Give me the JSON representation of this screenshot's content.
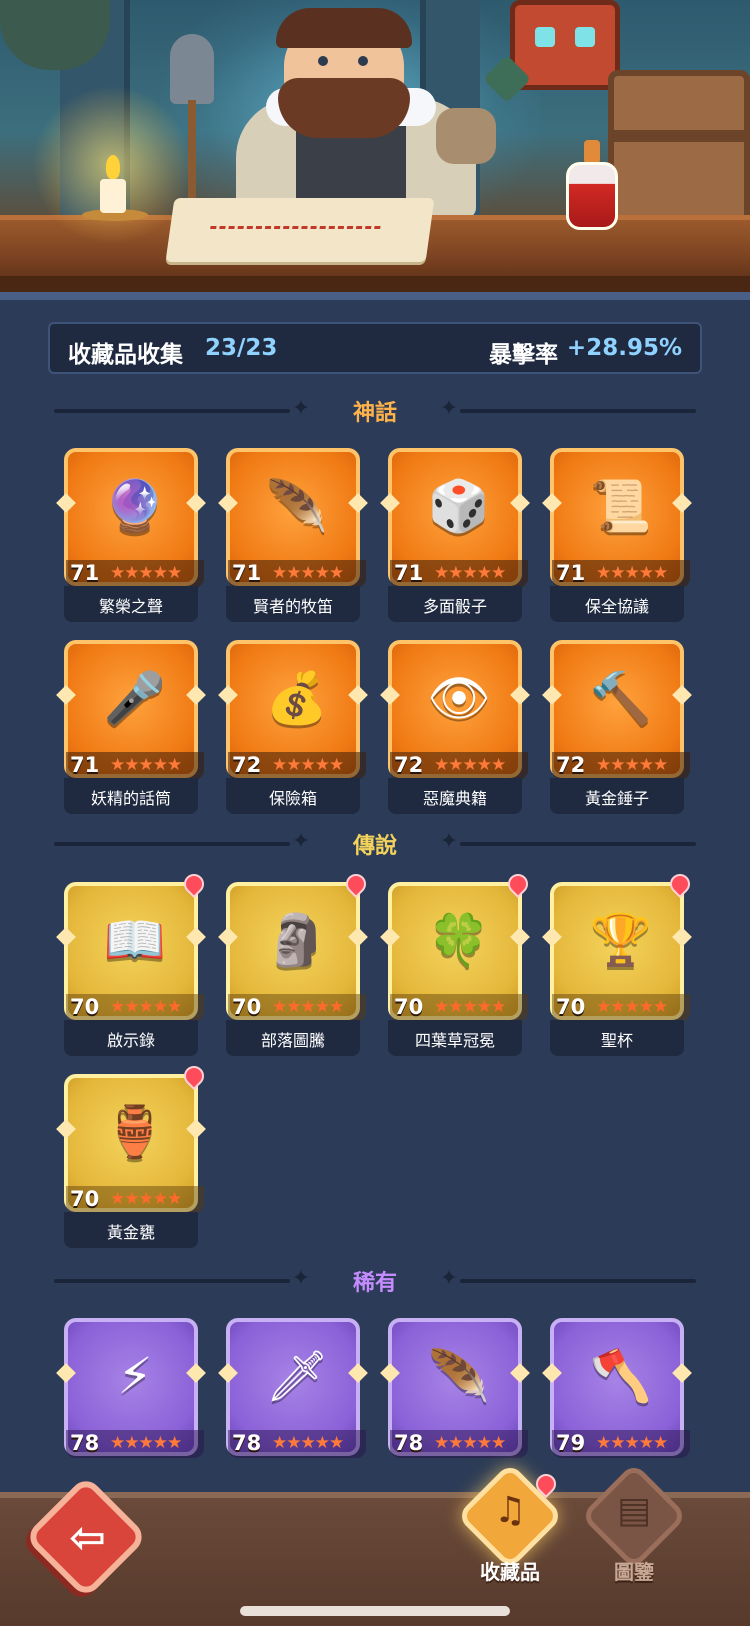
{
  "summary": {
    "label": "收藏品收集",
    "count": "23/23",
    "crit_label": "暴擊率",
    "crit_value": "+28.95%"
  },
  "colors": {
    "mythic": "#f07a14",
    "legend": "#e4b73a",
    "rare": "#8b62d8",
    "mythic_title": "#ffb34a",
    "legend_title": "#f4d35c",
    "rare_title": "#c58cff",
    "accent_blue": "#8fd2ff"
  },
  "sections": {
    "mythic": {
      "title": "神話"
    },
    "legend": {
      "title": "傳說"
    },
    "rare": {
      "title": "稀有"
    }
  },
  "mythic_items": [
    {
      "name": "繁榮之聲",
      "level": "71",
      "icon": "blue-orb-icon",
      "glyph": "🔮"
    },
    {
      "name": "賢者的牧笛",
      "level": "71",
      "icon": "feather-flute-icon",
      "glyph": "🪶"
    },
    {
      "name": "多面骰子",
      "level": "71",
      "icon": "dice-icon",
      "glyph": "🎲"
    },
    {
      "name": "保全協議",
      "level": "71",
      "icon": "contract-icon",
      "glyph": "📜"
    },
    {
      "name": "妖精的話筒",
      "level": "71",
      "icon": "fairy-microphone-icon",
      "glyph": "🎤"
    },
    {
      "name": "保險箱",
      "level": "72",
      "icon": "treasure-chest-icon",
      "glyph": "💰"
    },
    {
      "name": "惡魔典籍",
      "level": "72",
      "icon": "demon-tome-icon",
      "glyph": "👁"
    },
    {
      "name": "黃金錘子",
      "level": "72",
      "icon": "golden-hammer-icon",
      "glyph": "🔨"
    }
  ],
  "legend_items": [
    {
      "name": "啟示錄",
      "level": "70",
      "icon": "open-book-icon",
      "glyph": "📖"
    },
    {
      "name": "部落圖騰",
      "level": "70",
      "icon": "tribal-totem-icon",
      "glyph": "🗿"
    },
    {
      "name": "四葉草冠冕",
      "level": "70",
      "icon": "clover-crown-icon",
      "glyph": "🍀"
    },
    {
      "name": "聖杯",
      "level": "70",
      "icon": "grail-icon",
      "glyph": "🏆"
    },
    {
      "name": "黃金甕",
      "level": "70",
      "icon": "golden-urn-icon",
      "glyph": "🏺"
    }
  ],
  "rare_items": [
    {
      "level": "78",
      "icon": "lightning-card-icon",
      "glyph": "⚡"
    },
    {
      "level": "78",
      "icon": "ice-dagger-icon",
      "glyph": "🗡"
    },
    {
      "level": "78",
      "icon": "phoenix-feather-icon",
      "glyph": "🪶"
    },
    {
      "level": "79",
      "icon": "axe-icon",
      "glyph": "🪓"
    }
  ],
  "stars": "★★★★★",
  "nav": {
    "back_glyph": "⇦",
    "collection_label": "收藏品",
    "codex_label": "圖鑒"
  }
}
